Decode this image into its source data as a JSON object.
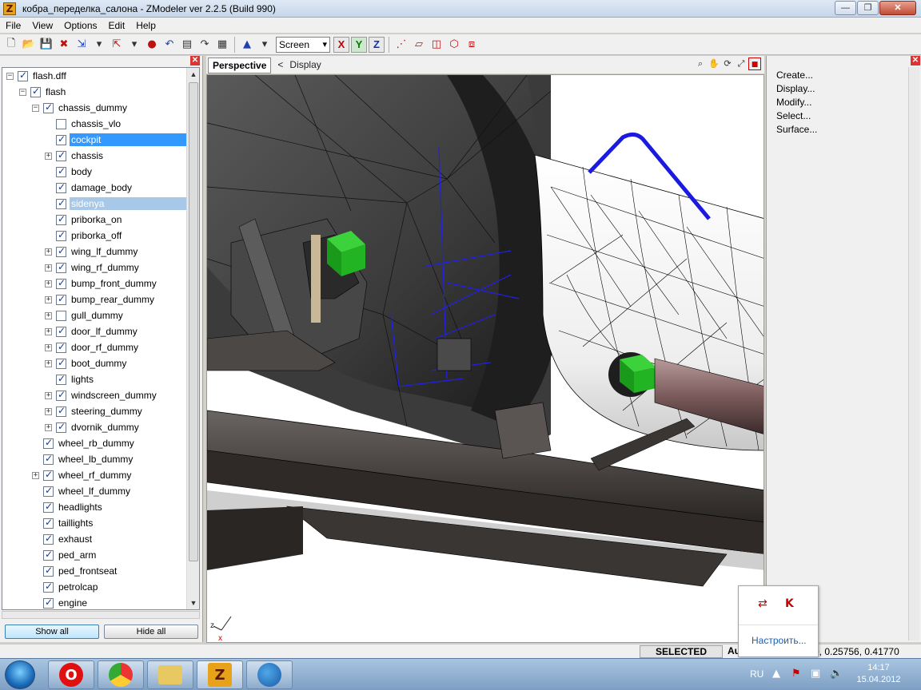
{
  "window": {
    "title": "кобра_переделка_салона - ZModeler ver 2.2.5 (Build 990)",
    "app_icon": "Z",
    "min": "—",
    "max": "❐",
    "close": "✕"
  },
  "menu": [
    "File",
    "View",
    "Options",
    "Edit",
    "Help"
  ],
  "toolbar": {
    "view_select": "Screen",
    "axes": [
      "X",
      "Y",
      "Z"
    ]
  },
  "tree": {
    "close": "✕",
    "items": [
      {
        "label": "flash.dff",
        "depth": 0,
        "expander": "−",
        "checked": true
      },
      {
        "label": "flash",
        "depth": 1,
        "expander": "−",
        "checked": true
      },
      {
        "label": "chassis_dummy",
        "depth": 2,
        "expander": "−",
        "checked": true
      },
      {
        "label": "chassis_vlo",
        "depth": 3,
        "expander": "",
        "checked": false
      },
      {
        "label": "cockpit",
        "depth": 3,
        "expander": "",
        "checked": true,
        "state": "sel"
      },
      {
        "label": "chassis",
        "depth": 3,
        "expander": "+",
        "checked": true
      },
      {
        "label": "body",
        "depth": 3,
        "expander": "",
        "checked": true
      },
      {
        "label": "damage_body",
        "depth": 3,
        "expander": "",
        "checked": true
      },
      {
        "label": "sidenya",
        "depth": 3,
        "expander": "",
        "checked": true,
        "state": "sel2"
      },
      {
        "label": "priborka_on",
        "depth": 3,
        "expander": "",
        "checked": true
      },
      {
        "label": "priborka_off",
        "depth": 3,
        "expander": "",
        "checked": true
      },
      {
        "label": "wing_lf_dummy",
        "depth": 3,
        "expander": "+",
        "checked": true
      },
      {
        "label": "wing_rf_dummy",
        "depth": 3,
        "expander": "+",
        "checked": true
      },
      {
        "label": "bump_front_dummy",
        "depth": 3,
        "expander": "+",
        "checked": true
      },
      {
        "label": "bump_rear_dummy",
        "depth": 3,
        "expander": "+",
        "checked": true
      },
      {
        "label": "gull_dummy",
        "depth": 3,
        "expander": "+",
        "checked": false
      },
      {
        "label": "door_lf_dummy",
        "depth": 3,
        "expander": "+",
        "checked": true
      },
      {
        "label": "door_rf_dummy",
        "depth": 3,
        "expander": "+",
        "checked": true
      },
      {
        "label": "boot_dummy",
        "depth": 3,
        "expander": "+",
        "checked": true
      },
      {
        "label": "lights",
        "depth": 3,
        "expander": "",
        "checked": true
      },
      {
        "label": "windscreen_dummy",
        "depth": 3,
        "expander": "+",
        "checked": true
      },
      {
        "label": "steering_dummy",
        "depth": 3,
        "expander": "+",
        "checked": true
      },
      {
        "label": "dvornik_dummy",
        "depth": 3,
        "expander": "+",
        "checked": true
      },
      {
        "label": "wheel_rb_dummy",
        "depth": 2,
        "expander": "",
        "checked": true
      },
      {
        "label": "wheel_lb_dummy",
        "depth": 2,
        "expander": "",
        "checked": true
      },
      {
        "label": "wheel_rf_dummy",
        "depth": 2,
        "expander": "+",
        "checked": true
      },
      {
        "label": "wheel_lf_dummy",
        "depth": 2,
        "expander": "",
        "checked": true
      },
      {
        "label": "headlights",
        "depth": 2,
        "expander": "",
        "checked": true
      },
      {
        "label": "taillights",
        "depth": 2,
        "expander": "",
        "checked": true
      },
      {
        "label": "exhaust",
        "depth": 2,
        "expander": "",
        "checked": true
      },
      {
        "label": "ped_arm",
        "depth": 2,
        "expander": "",
        "checked": true
      },
      {
        "label": "ped_frontseat",
        "depth": 2,
        "expander": "",
        "checked": true
      },
      {
        "label": "petrolcap",
        "depth": 2,
        "expander": "",
        "checked": true
      },
      {
        "label": "engine",
        "depth": 2,
        "expander": "",
        "checked": true
      }
    ],
    "show_all": "Show all",
    "hide_all": "Hide all"
  },
  "viewport": {
    "tab": "Perspective",
    "crumb_arrow": "<",
    "crumb": "Display",
    "axis_z": "z",
    "axis_x": "x"
  },
  "commands": {
    "close": "✕",
    "items": [
      "Create...",
      "Display...",
      "Modify...",
      "Select...",
      "Surface..."
    ]
  },
  "status": {
    "mode": "SELECTED MODE",
    "au": "Au",
    "coords": "0, 0.25756, 0.41770"
  },
  "tray_popup": {
    "action": "Настроить..."
  },
  "taskbar": {
    "lang": "RU",
    "time": "14:17",
    "date": "15.04.2012"
  },
  "colors": {
    "selection": "#3399ff",
    "dummy_cube": "#22b422",
    "wire": "#1a1ae0"
  }
}
